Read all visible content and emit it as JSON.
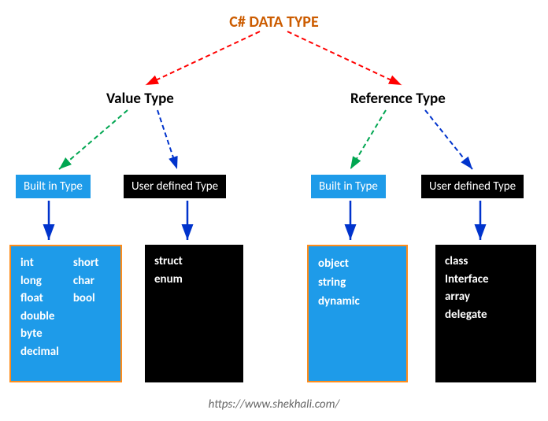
{
  "title": "C# DATA TYPE",
  "value_type": {
    "label": "Value Type",
    "built_in": {
      "label": "Built in Type",
      "items_col1": [
        "int",
        "long",
        "float",
        "double",
        "byte",
        "decimal"
      ],
      "items_col2": [
        "short",
        "char",
        "bool"
      ]
    },
    "user_defined": {
      "label": "User defined Type",
      "items": [
        "struct",
        "enum"
      ]
    }
  },
  "reference_type": {
    "label": "Reference Type",
    "built_in": {
      "label": "Built in Type",
      "items": [
        "object",
        "string",
        "dynamic"
      ]
    },
    "user_defined": {
      "label": "User defined Type",
      "items": [
        "class",
        "Interface",
        "array",
        "delegate"
      ]
    }
  },
  "footer": "https://www.shekhali.com/",
  "colors": {
    "title": "#cc5c00",
    "blue": "#1e9be9",
    "black": "#000000",
    "arrow_red": "#ff0000",
    "arrow_green": "#00a651",
    "arrow_blue": "#0033cc"
  }
}
